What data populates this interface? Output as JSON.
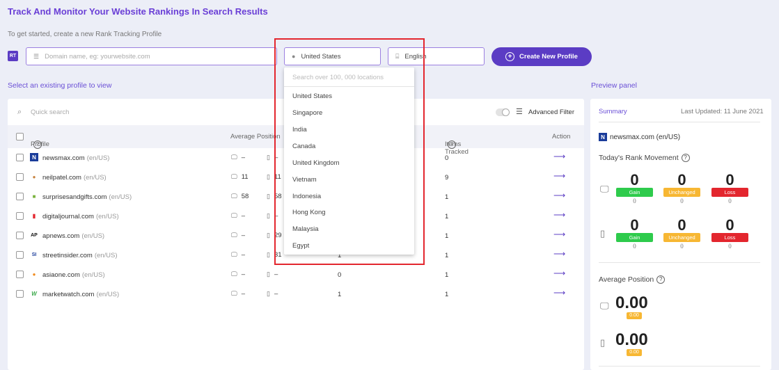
{
  "header": {
    "title": "Track And Monitor Your Website Rankings In Search Results",
    "subtitle": "To get started, create a new Rank Tracking Profile",
    "rt_badge": "RT",
    "domain_placeholder": "Domain name, eg: yourwebsite.com",
    "country_value": "United States",
    "language_value": "English",
    "create_button": "Create New Profile"
  },
  "labels": {
    "select_profile": "Select an existing profile to view",
    "preview_panel": "Preview panel"
  },
  "table": {
    "quick_search_placeholder": "Quick search",
    "advanced_filter": "Advanced Filter",
    "col_profile": "Profile",
    "col_avg_position": "Average Position",
    "col_items": "Items Tracked",
    "col_action": "Action",
    "rows": [
      {
        "domain": "newsmax.com",
        "locale": "(en/US)",
        "desktop": "–",
        "mobile": "–",
        "mid": "",
        "items": "0",
        "favicon": "N"
      },
      {
        "domain": "neilpatel.com",
        "locale": "(en/US)",
        "desktop": "11",
        "mobile": "11",
        "mid": "",
        "items": "9",
        "favicon": "●"
      },
      {
        "domain": "surprisesandgifts.com",
        "locale": "(en/US)",
        "desktop": "58",
        "mobile": "58",
        "mid": "",
        "items": "1",
        "favicon": "■"
      },
      {
        "domain": "digitaljournal.com",
        "locale": "(en/US)",
        "desktop": "–",
        "mobile": "–",
        "mid": "",
        "items": "1",
        "favicon": "▮"
      },
      {
        "domain": "apnews.com",
        "locale": "(en/US)",
        "desktop": "–",
        "mobile": "29",
        "mid": "",
        "items": "1",
        "favicon": "AP"
      },
      {
        "domain": "streetinsider.com",
        "locale": "(en/US)",
        "desktop": "–",
        "mobile": "31",
        "mid": "1",
        "items": "1",
        "favicon": "SI"
      },
      {
        "domain": "asiaone.com",
        "locale": "(en/US)",
        "desktop": "–",
        "mobile": "–",
        "mid": "0",
        "items": "1",
        "favicon": "●"
      },
      {
        "domain": "marketwatch.com",
        "locale": "(en/US)",
        "desktop": "–",
        "mobile": "–",
        "mid": "1",
        "items": "1",
        "favicon": "W"
      }
    ]
  },
  "dropdown": {
    "search_placeholder": "Search over 100, 000 locations",
    "options": [
      "United States",
      "Singapore",
      "India",
      "Canada",
      "United Kingdom",
      "Vietnam",
      "Indonesia",
      "Hong Kong",
      "Malaysia",
      "Egypt"
    ]
  },
  "preview": {
    "summary": "Summary",
    "last_updated": "Last Updated: 11 June 2021",
    "domain": "newsmax.com (en/US)",
    "rank_movement_title": "Today's Rank Movement",
    "desktop": {
      "gain": "0",
      "unchanged": "0",
      "loss": "0",
      "gain_sub": "0",
      "unchanged_sub": "0",
      "loss_sub": "0"
    },
    "mobile": {
      "gain": "0",
      "unchanged": "0",
      "loss": "0",
      "gain_sub": "0",
      "unchanged_sub": "0",
      "loss_sub": "0"
    },
    "gain_label": "Gain",
    "unchanged_label": "Unchanged",
    "loss_label": "Loss",
    "avg_position_title": "Average Position",
    "avg_desktop": "0.00",
    "avg_mobile": "0.00",
    "avg_desktop_badge": "0.00",
    "avg_mobile_badge": "0.00"
  },
  "colors": {
    "accent": "#5b3cc4",
    "gain": "#2ecb4c",
    "unchanged": "#f7b733",
    "loss": "#e3262e"
  }
}
